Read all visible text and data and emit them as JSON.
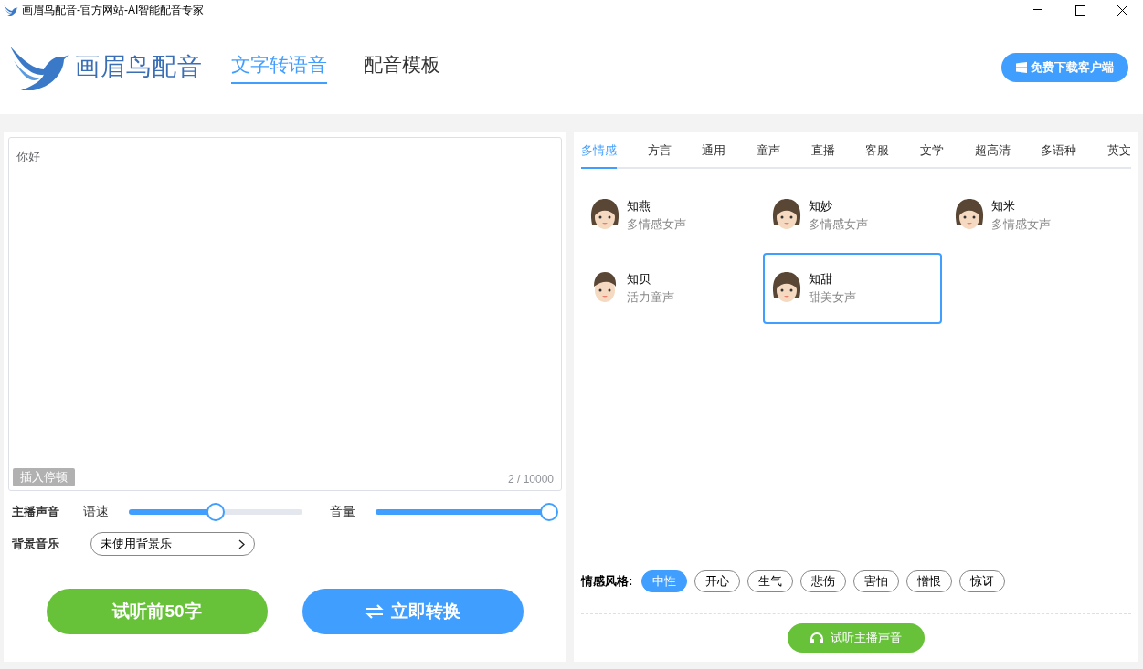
{
  "window": {
    "title": "画眉鸟配音-官方网站-AI智能配音专家"
  },
  "logo": {
    "text": "画眉鸟配音"
  },
  "nav": [
    {
      "label": "文字转语音",
      "selected": true
    },
    {
      "label": "配音模板",
      "selected": false
    }
  ],
  "download_button": "免费下载客户端",
  "editor": {
    "value": "你好",
    "pause_button": "插入停顿",
    "counter": "2 / 10000"
  },
  "voice_settings": {
    "label": "主播声音",
    "sliders": [
      {
        "label": "语速",
        "level": 0.5
      },
      {
        "label": "音量",
        "level": 1.0
      }
    ]
  },
  "music": {
    "label": "背景音乐",
    "value": "未使用背景乐"
  },
  "actions": [
    {
      "label": "试听前50字",
      "kind": "preview"
    },
    {
      "label": "立即转换",
      "kind": "convert"
    }
  ],
  "voice_tabs": [
    {
      "label": "多情感",
      "selected": true
    },
    {
      "label": "方言",
      "selected": false
    },
    {
      "label": "通用",
      "selected": false
    },
    {
      "label": "童声",
      "selected": false
    },
    {
      "label": "直播",
      "selected": false
    },
    {
      "label": "客服",
      "selected": false
    },
    {
      "label": "文学",
      "selected": false
    },
    {
      "label": "超高清",
      "selected": false
    },
    {
      "label": "多语种",
      "selected": false
    },
    {
      "label": "英文",
      "selected": false
    }
  ],
  "voices": [
    {
      "name": "知燕",
      "desc": "多情感女声",
      "kind": "female",
      "selected": false
    },
    {
      "name": "知妙",
      "desc": "多情感女声",
      "kind": "female",
      "selected": false
    },
    {
      "name": "知米",
      "desc": "多情感女声",
      "kind": "female",
      "selected": false
    },
    {
      "name": "知贝",
      "desc": "活力童声",
      "kind": "child",
      "selected": false
    },
    {
      "name": "知甜",
      "desc": "甜美女声",
      "kind": "female",
      "selected": true
    }
  ],
  "emotion": {
    "label": "情感风格:",
    "styles": [
      {
        "label": "中性",
        "selected": true
      },
      {
        "label": "开心",
        "selected": false
      },
      {
        "label": "生气",
        "selected": false
      },
      {
        "label": "悲伤",
        "selected": false
      },
      {
        "label": "害怕",
        "selected": false
      },
      {
        "label": "憎恨",
        "selected": false
      },
      {
        "label": "惊讶",
        "selected": false
      }
    ]
  },
  "listen_button": "试听主播声音"
}
